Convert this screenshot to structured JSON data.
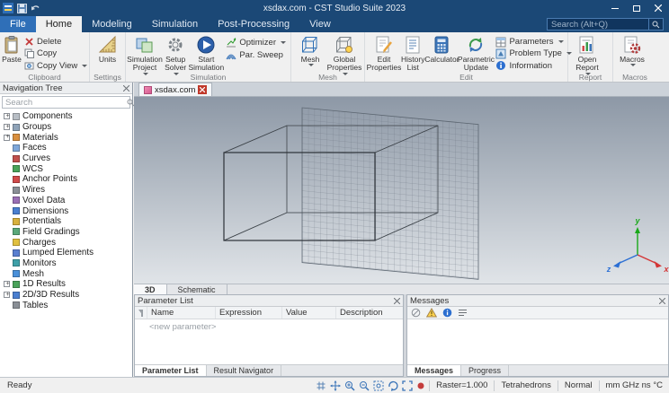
{
  "titlebar": {
    "title": "xsdax.com - CST Studio Suite 2023"
  },
  "ribbon_tabs": [
    "File",
    "Home",
    "Modeling",
    "Simulation",
    "Post-Processing",
    "View"
  ],
  "search": {
    "placeholder": "Search (Alt+Q)"
  },
  "ribbon": {
    "groups": {
      "clipboard": {
        "label": "Clipboard",
        "paste": "Paste",
        "delete": "Delete",
        "copy": "Copy",
        "copy_view": "Copy View"
      },
      "settings": {
        "label": "Settings",
        "units": "Units"
      },
      "simulation": {
        "label": "Simulation",
        "simulation_project": "Simulation Project",
        "setup_solver": "Setup Solver",
        "start_simulation": "Start Simulation",
        "optimizer": "Optimizer",
        "par_sweep": "Par. Sweep"
      },
      "mesh": {
        "label": "Mesh",
        "mesh": "Mesh",
        "global_properties": "Global Properties"
      },
      "edit": {
        "label": "Edit",
        "edit_properties": "Edit Properties",
        "history_list": "History List",
        "calculator": "Calculator",
        "parametric_update": "Parametric Update",
        "parameters": "Parameters",
        "problem_type": "Problem Type",
        "information": "Information"
      },
      "report": {
        "label": "Report",
        "open_report": "Open Report"
      },
      "macros": {
        "label": "Macros",
        "macros": "Macros"
      }
    }
  },
  "nav_tree": {
    "title": "Navigation Tree",
    "search_placeholder": "Search",
    "items": [
      "Components",
      "Groups",
      "Materials",
      "Faces",
      "Curves",
      "WCS",
      "Anchor Points",
      "Wires",
      "Voxel Data",
      "Dimensions",
      "Potentials",
      "Field Gradings",
      "Charges",
      "Lumped Elements",
      "Monitors",
      "Mesh",
      "1D Results",
      "2D/3D Results",
      "Tables"
    ]
  },
  "document_tabs": {
    "active": "xsdax.com"
  },
  "view_tabs": [
    "3D",
    "Schematic"
  ],
  "viewport": {
    "axis_x": "x",
    "axis_y": "y",
    "axis_z": "z"
  },
  "parameter_panel": {
    "title": "Parameter List",
    "columns": [
      "Name",
      "Expression",
      "Value",
      "Description"
    ],
    "placeholder_row": "<new parameter>",
    "tabs": [
      "Parameter List",
      "Result Navigator"
    ]
  },
  "messages_panel": {
    "title": "Messages",
    "tabs": [
      "Messages",
      "Progress"
    ]
  },
  "status_bar": {
    "ready": "Ready",
    "raster": "Raster=1.000",
    "mesh_type": "Tetrahedrons",
    "render_mode": "Normal",
    "units": "mm GHz ns °C"
  },
  "colors": {
    "titlebar": "#1b4876",
    "accent": "#2f6fb8",
    "viewport_top": "#8d98a6",
    "viewport_bottom": "#e0e4e8"
  }
}
